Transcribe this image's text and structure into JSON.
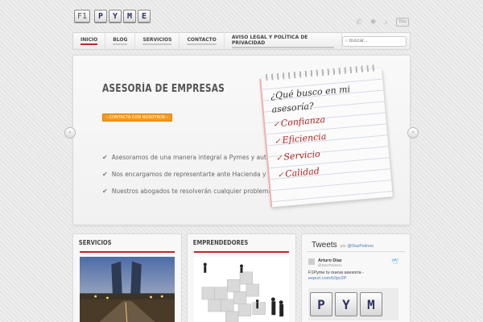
{
  "logo": {
    "prefix": "F1",
    "letters": [
      "P",
      "Y",
      "M",
      "E"
    ]
  },
  "social": {
    "icons": [
      "skype-icon",
      "globe-icon",
      "mic-icon",
      "youtube-icon"
    ],
    "youtube_label": "You"
  },
  "nav": {
    "items": [
      {
        "label": "Inicio",
        "active": true
      },
      {
        "label": "Blog"
      },
      {
        "label": "Servicios"
      },
      {
        "label": "Contacto"
      },
      {
        "label": "Aviso legal y política de privacidad"
      }
    ],
    "search_placeholder": "buscar...",
    "accent": "#c0272d"
  },
  "slider": {
    "title": "ASESORÍA DE EMPRESAS",
    "cta_label": "› CONTACTA CON NOSOTROS ›",
    "cta_color": "#f29a1c",
    "features": [
      "Asesoramos de una manera integral a Pymes y autónomos",
      "Nos encargamos de representarte ante Hacienda y Seguridad Social",
      "Nuestros abogados te resolverán cualquier problema jurídico"
    ],
    "note": {
      "question_line1": "¿Qué busco en mi",
      "question_line2": "asesoría?",
      "items": [
        "Confianza",
        "Eficiencia",
        "Servicio",
        "Calidad"
      ],
      "item_color": "#b21e1e"
    },
    "prev_label": "‹",
    "next_label": "›",
    "active_dot": 1
  },
  "boxes": {
    "servicios": {
      "title": "SERVICIOS"
    },
    "emprendedores": {
      "title": "EMPRENDEDORES"
    },
    "tweets": {
      "title": "Tweets",
      "via_prefix": "por",
      "via_handle": "@DiazPedrero",
      "tweet": {
        "name": "Arturo Díaz",
        "handle": "@DiazPedrero",
        "text": "F1Pyme tu nueva asesoría -",
        "link": "eepurl.com/b3pv2P",
        "media_letters": [
          "P",
          "Y",
          "M"
        ]
      }
    }
  }
}
